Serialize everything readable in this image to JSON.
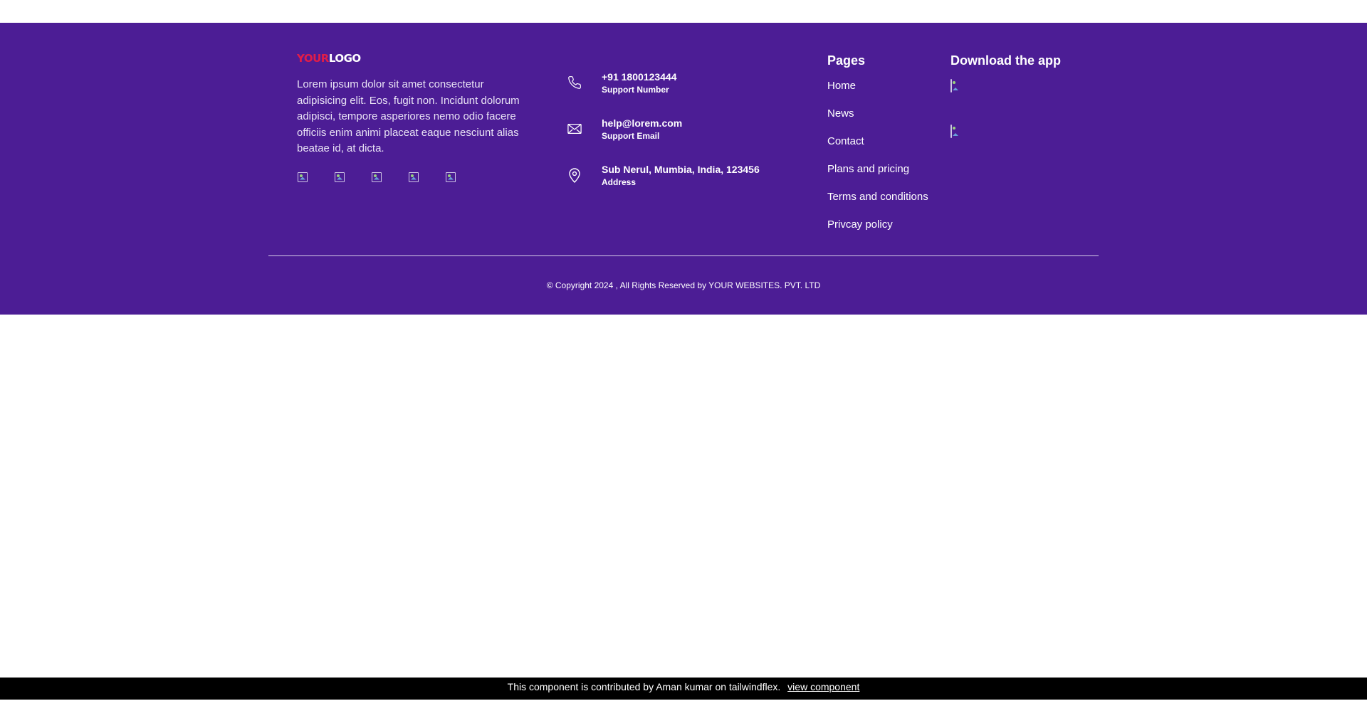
{
  "footer": {
    "logo": {
      "part_a": "YOUR",
      "part_b": "LOGO"
    },
    "description": "Lorem ipsum dolor sit amet consectetur adipisicing elit. Eos, fugit non. Incidunt dolorum adipisci, tempore asperiores nemo odio facere officiis enim animi placeat eaque nesciunt alias beatae id, at dicta.",
    "socials": [
      {
        "icon": "broken-image-icon"
      },
      {
        "icon": "broken-image-icon"
      },
      {
        "icon": "broken-image-icon"
      },
      {
        "icon": "broken-image-icon"
      },
      {
        "icon": "broken-image-icon"
      }
    ],
    "contacts": [
      {
        "icon": "phone-icon",
        "value": "+91 1800123444",
        "label": "Support Number"
      },
      {
        "icon": "mail-icon",
        "value": "help@lorem.com",
        "label": "Support Email"
      },
      {
        "icon": "location-pin-icon",
        "value": "Sub Nerul, Mumbia, India, 123456",
        "label": "Address"
      }
    ],
    "pages": {
      "title": "Pages",
      "items": [
        "Home",
        "News",
        "Contact",
        "Plans and pricing",
        "Terms and conditions",
        "Privcay policy"
      ]
    },
    "app": {
      "title": "Download the app",
      "badges": [
        "broken-image-icon",
        "broken-image-icon"
      ]
    },
    "copyright": "© Copyright 2024 , All Rights Reserved by YOUR WEBSITES. PVT. LTD"
  },
  "credit": {
    "text": "This component is contributed by Aman kumar on tailwindflex.",
    "link": "view component"
  },
  "colors": {
    "footer_bg": "#4c1d95",
    "logo_accent": "#e11d48",
    "credit_bg": "#000000"
  }
}
